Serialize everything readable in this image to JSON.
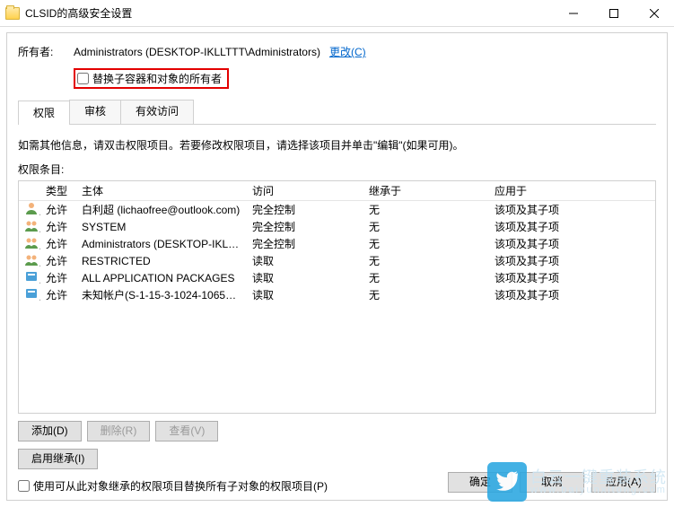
{
  "window": {
    "title": "CLSID的高级安全设置"
  },
  "owner": {
    "label": "所有者:",
    "value": "Administrators (DESKTOP-IKLLTTT\\Administrators)",
    "change_link": "更改(C)"
  },
  "replace_owner_checkbox": "替换子容器和对象的所有者",
  "tabs": {
    "permissions": "权限",
    "auditing": "审核",
    "effective": "有效访问"
  },
  "instruction": "如需其他信息，请双击权限项目。若要修改权限项目，请选择该项目并单击\"编辑\"(如果可用)。",
  "list_label": "权限条目:",
  "columns": {
    "type": "类型",
    "principal": "主体",
    "access": "访问",
    "inherited": "继承于",
    "applies": "应用于"
  },
  "entries": [
    {
      "icon": "user",
      "type": "允许",
      "principal": "白利超 (lichaofree@outlook.com)",
      "access": "完全控制",
      "inherited": "无",
      "applies": "该项及其子项"
    },
    {
      "icon": "group",
      "type": "允许",
      "principal": "SYSTEM",
      "access": "完全控制",
      "inherited": "无",
      "applies": "该项及其子项"
    },
    {
      "icon": "group",
      "type": "允许",
      "principal": "Administrators (DESKTOP-IKLLT...",
      "access": "完全控制",
      "inherited": "无",
      "applies": "该项及其子项"
    },
    {
      "icon": "group",
      "type": "允许",
      "principal": "RESTRICTED",
      "access": "读取",
      "inherited": "无",
      "applies": "该项及其子项"
    },
    {
      "icon": "pkg",
      "type": "允许",
      "principal": "ALL APPLICATION PACKAGES",
      "access": "读取",
      "inherited": "无",
      "applies": "该项及其子项"
    },
    {
      "icon": "pkg",
      "type": "允许",
      "principal": "未知帐户(S-1-15-3-1024-1065365...",
      "access": "读取",
      "inherited": "无",
      "applies": "该项及其子项"
    }
  ],
  "buttons": {
    "add": "添加(D)",
    "remove": "删除(R)",
    "view": "查看(V)",
    "enable_inherit": "启用继承(I)"
  },
  "replace_child_checkbox": "使用可从此对象继承的权限项目替换所有子对象的权限项目(P)",
  "dialog_buttons": {
    "ok": "确定",
    "cancel": "取消",
    "apply": "应用(A)"
  },
  "watermark": {
    "line1": "白云一键重装系统",
    "line2": "www.baiyunxitong.com"
  }
}
